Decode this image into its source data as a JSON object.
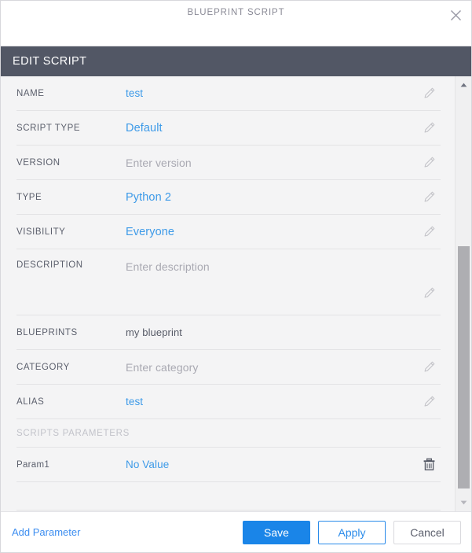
{
  "window": {
    "title": "BLUEPRINT SCRIPT",
    "close_icon": "close-icon"
  },
  "section": {
    "header": "EDIT SCRIPT"
  },
  "form": {
    "rows": [
      {
        "label": "NAME",
        "value": "test",
        "value_kind": "link",
        "icon": "pencil-icon"
      },
      {
        "label": "SCRIPT TYPE",
        "value": "Default",
        "value_kind": "link-strong",
        "icon": "pencil-icon"
      },
      {
        "label": "VERSION",
        "value": "Enter version",
        "value_kind": "placeholder",
        "icon": "pencil-icon"
      },
      {
        "label": "TYPE",
        "value": "Python 2",
        "value_kind": "link-strong",
        "icon": "pencil-icon"
      },
      {
        "label": "VISIBILITY",
        "value": "Everyone",
        "value_kind": "link-strong",
        "icon": "pencil-icon"
      },
      {
        "label": "DESCRIPTION",
        "value": "Enter description",
        "value_kind": "placeholder",
        "icon": "pencil-icon"
      },
      {
        "label": "BLUEPRINTS",
        "value": "my blueprint",
        "value_kind": "static",
        "icon": ""
      },
      {
        "label": "CATEGORY",
        "value": "Enter category",
        "value_kind": "placeholder",
        "icon": "pencil-icon"
      },
      {
        "label": "ALIAS",
        "value": "test",
        "value_kind": "link",
        "icon": "pencil-icon"
      }
    ]
  },
  "parameters": {
    "heading": "SCRIPTS PARAMETERS",
    "items": [
      {
        "name": "Param1",
        "value": "No Value",
        "icon": "trash-icon"
      }
    ]
  },
  "scrollbar": {
    "up_icon": "chevron-up-icon",
    "down_icon": "chevron-down-icon"
  },
  "footer": {
    "add_parameter": "Add Parameter",
    "save": "Save",
    "apply": "Apply",
    "cancel": "Cancel"
  },
  "colors": {
    "accent_blue": "#1a85e8",
    "link_blue": "#3d9ae8",
    "header_bg": "#525765",
    "body_bg": "#f4f4f5"
  }
}
